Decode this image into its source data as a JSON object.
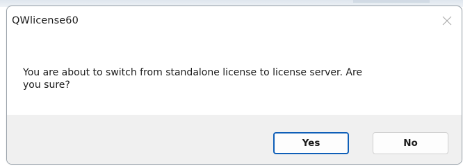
{
  "window": {
    "title": "QWlicense60"
  },
  "dialog": {
    "message_line1": "You are about to switch from standalone license to license server. Are",
    "message_line2": "you sure?",
    "buttons": {
      "yes_label": "Yes",
      "no_label": "No"
    }
  },
  "icons": {
    "close": "close-icon"
  },
  "colors": {
    "default_button_border": "#0f5fb8",
    "footer_background": "#f0f0f0"
  }
}
